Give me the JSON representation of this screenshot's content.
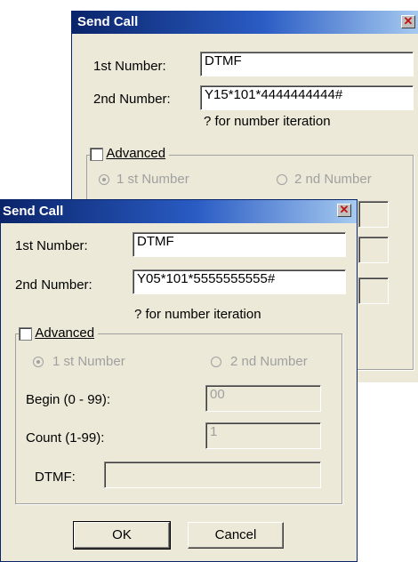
{
  "back_dialog": {
    "title": "Send Call",
    "first_number_label": "1st Number:",
    "first_number_value": "DTMF",
    "second_number_label": "2nd Number:",
    "second_number_value": "Y15*101*4444444444#",
    "hint": "? for number iteration",
    "advanced_label": "Advanced",
    "radio_first": "1 st Number",
    "radio_second": "2 nd Number"
  },
  "front_dialog": {
    "title": "Send Call",
    "first_number_label": "1st Number:",
    "first_number_value": "DTMF",
    "second_number_label": "2nd Number:",
    "second_number_value": "Y05*101*5555555555#",
    "hint": "? for number iteration",
    "advanced_label": "Advanced",
    "radio_first": "1 st Number",
    "radio_second": "2 nd Number",
    "begin_label": "Begin (0 - 99):",
    "begin_value": "00",
    "count_label": "Count (1-99):",
    "count_value": "1",
    "dtmf_label": "DTMF:",
    "dtmf_value": "",
    "ok_label": "OK",
    "cancel_label": "Cancel"
  },
  "icons": {
    "close": "close-icon"
  },
  "colors": {
    "titlebar": "#0a246a",
    "dialog_bg": "#ece9d8"
  }
}
